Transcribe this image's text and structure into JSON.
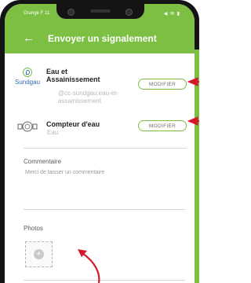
{
  "status_bar": {
    "carrier": "Orange F  11:",
    "icons": "◀ ✉ ▮"
  },
  "header": {
    "back_icon": "arrow-left-icon",
    "title": "Envoyer un signalement"
  },
  "service": {
    "logo_text": "Sundgau",
    "name": "Eau et Assainissement",
    "subtitle": "@cc-sundgau:eau-et-assainissement",
    "button_label": "MODIFIER"
  },
  "meter": {
    "icon": "water-meter-icon",
    "name": "Compteur d'eau",
    "subtitle": "Eau",
    "button_label": "MODIFIER"
  },
  "comment": {
    "label": "Commentaire",
    "placeholder": "Merci de laisser un commentaire"
  },
  "photos": {
    "label": "Photos",
    "add_icon": "plus-circle-icon"
  },
  "colors": {
    "brand_green": "#7cbf43",
    "annotation_red": "#d6182b",
    "logo_blue": "#2f6bb5"
  }
}
